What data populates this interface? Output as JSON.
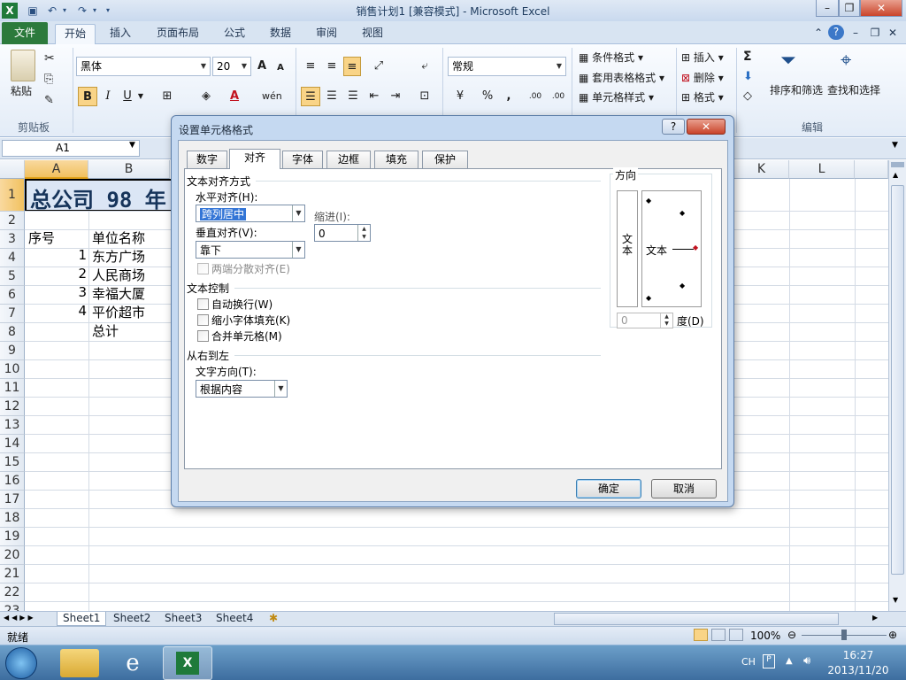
{
  "window": {
    "title": "销售计划1 [兼容模式] - Microsoft Excel"
  },
  "ribbon_tabs": [
    "文件",
    "开始",
    "插入",
    "页面布局",
    "公式",
    "数据",
    "审阅",
    "视图"
  ],
  "clipboard": {
    "paste": "粘贴",
    "group": "剪贴板"
  },
  "font": {
    "name": "黑体",
    "size": "20",
    "bold": "B",
    "italic": "I",
    "underline": "U",
    "grow": "A",
    "shrink": "A"
  },
  "number": {
    "format": "常规",
    "percent": "%",
    "comma": ",",
    "inc": ".00",
    "dec": ".00"
  },
  "styles": {
    "conditional": "条件格式",
    "table": "套用表格格式",
    "cell": "单元格样式"
  },
  "cells_group": {
    "insert": "插入",
    "delete": "删除",
    "format": "格式"
  },
  "editing": {
    "sort": "排序和筛选",
    "find": "查找和选择",
    "group": "编辑",
    "sigma": "Σ"
  },
  "namebox": "A1",
  "columns": [
    "A",
    "B",
    "K",
    "L"
  ],
  "rows": [
    "1",
    "2",
    "3",
    "4",
    "5",
    "6",
    "7",
    "8",
    "9",
    "10",
    "11",
    "12",
    "13",
    "14",
    "15",
    "16",
    "17",
    "18",
    "19",
    "20",
    "21",
    "22",
    "23"
  ],
  "cells": {
    "title": "总公司 98 年",
    "a3": "序号",
    "b3": "单位名称",
    "a4": "1",
    "b4": "东方广场",
    "a5": "2",
    "b5": "人民商场",
    "a6": "3",
    "b6": "幸福大厦",
    "a7": "4",
    "b7": "平价超市",
    "b8": "总计"
  },
  "sheets": [
    "Sheet1",
    "Sheet2",
    "Sheet3",
    "Sheet4"
  ],
  "status": {
    "ready": "就绪",
    "zoom": "100%"
  },
  "taskbar": {
    "lang": "CH",
    "time": "16:27",
    "date": "2013/11/20"
  },
  "dialog": {
    "title": "设置单元格格式",
    "help": "?",
    "tabs": [
      "数字",
      "对齐",
      "字体",
      "边框",
      "填充",
      "保护"
    ],
    "text_align_section": "文本对齐方式",
    "h_align_label": "水平对齐(H):",
    "h_align_value": "跨列居中",
    "v_align_label": "垂直对齐(V):",
    "v_align_value": "靠下",
    "indent_label": "缩进(I):",
    "indent_value": "0",
    "justify_distributed": "两端分散对齐(E)",
    "text_control_section": "文本控制",
    "wrap": "自动换行(W)",
    "shrink": "缩小字体填充(K)",
    "merge": "合并单元格(M)",
    "rtl_section": "从右到左",
    "text_dir_label": "文字方向(T):",
    "text_dir_value": "根据内容",
    "orientation_section": "方向",
    "vertical_text": "文本",
    "orient_text": "文本",
    "degrees_value": "0",
    "degrees_label": "度(D)",
    "ok": "确定",
    "cancel": "取消"
  }
}
